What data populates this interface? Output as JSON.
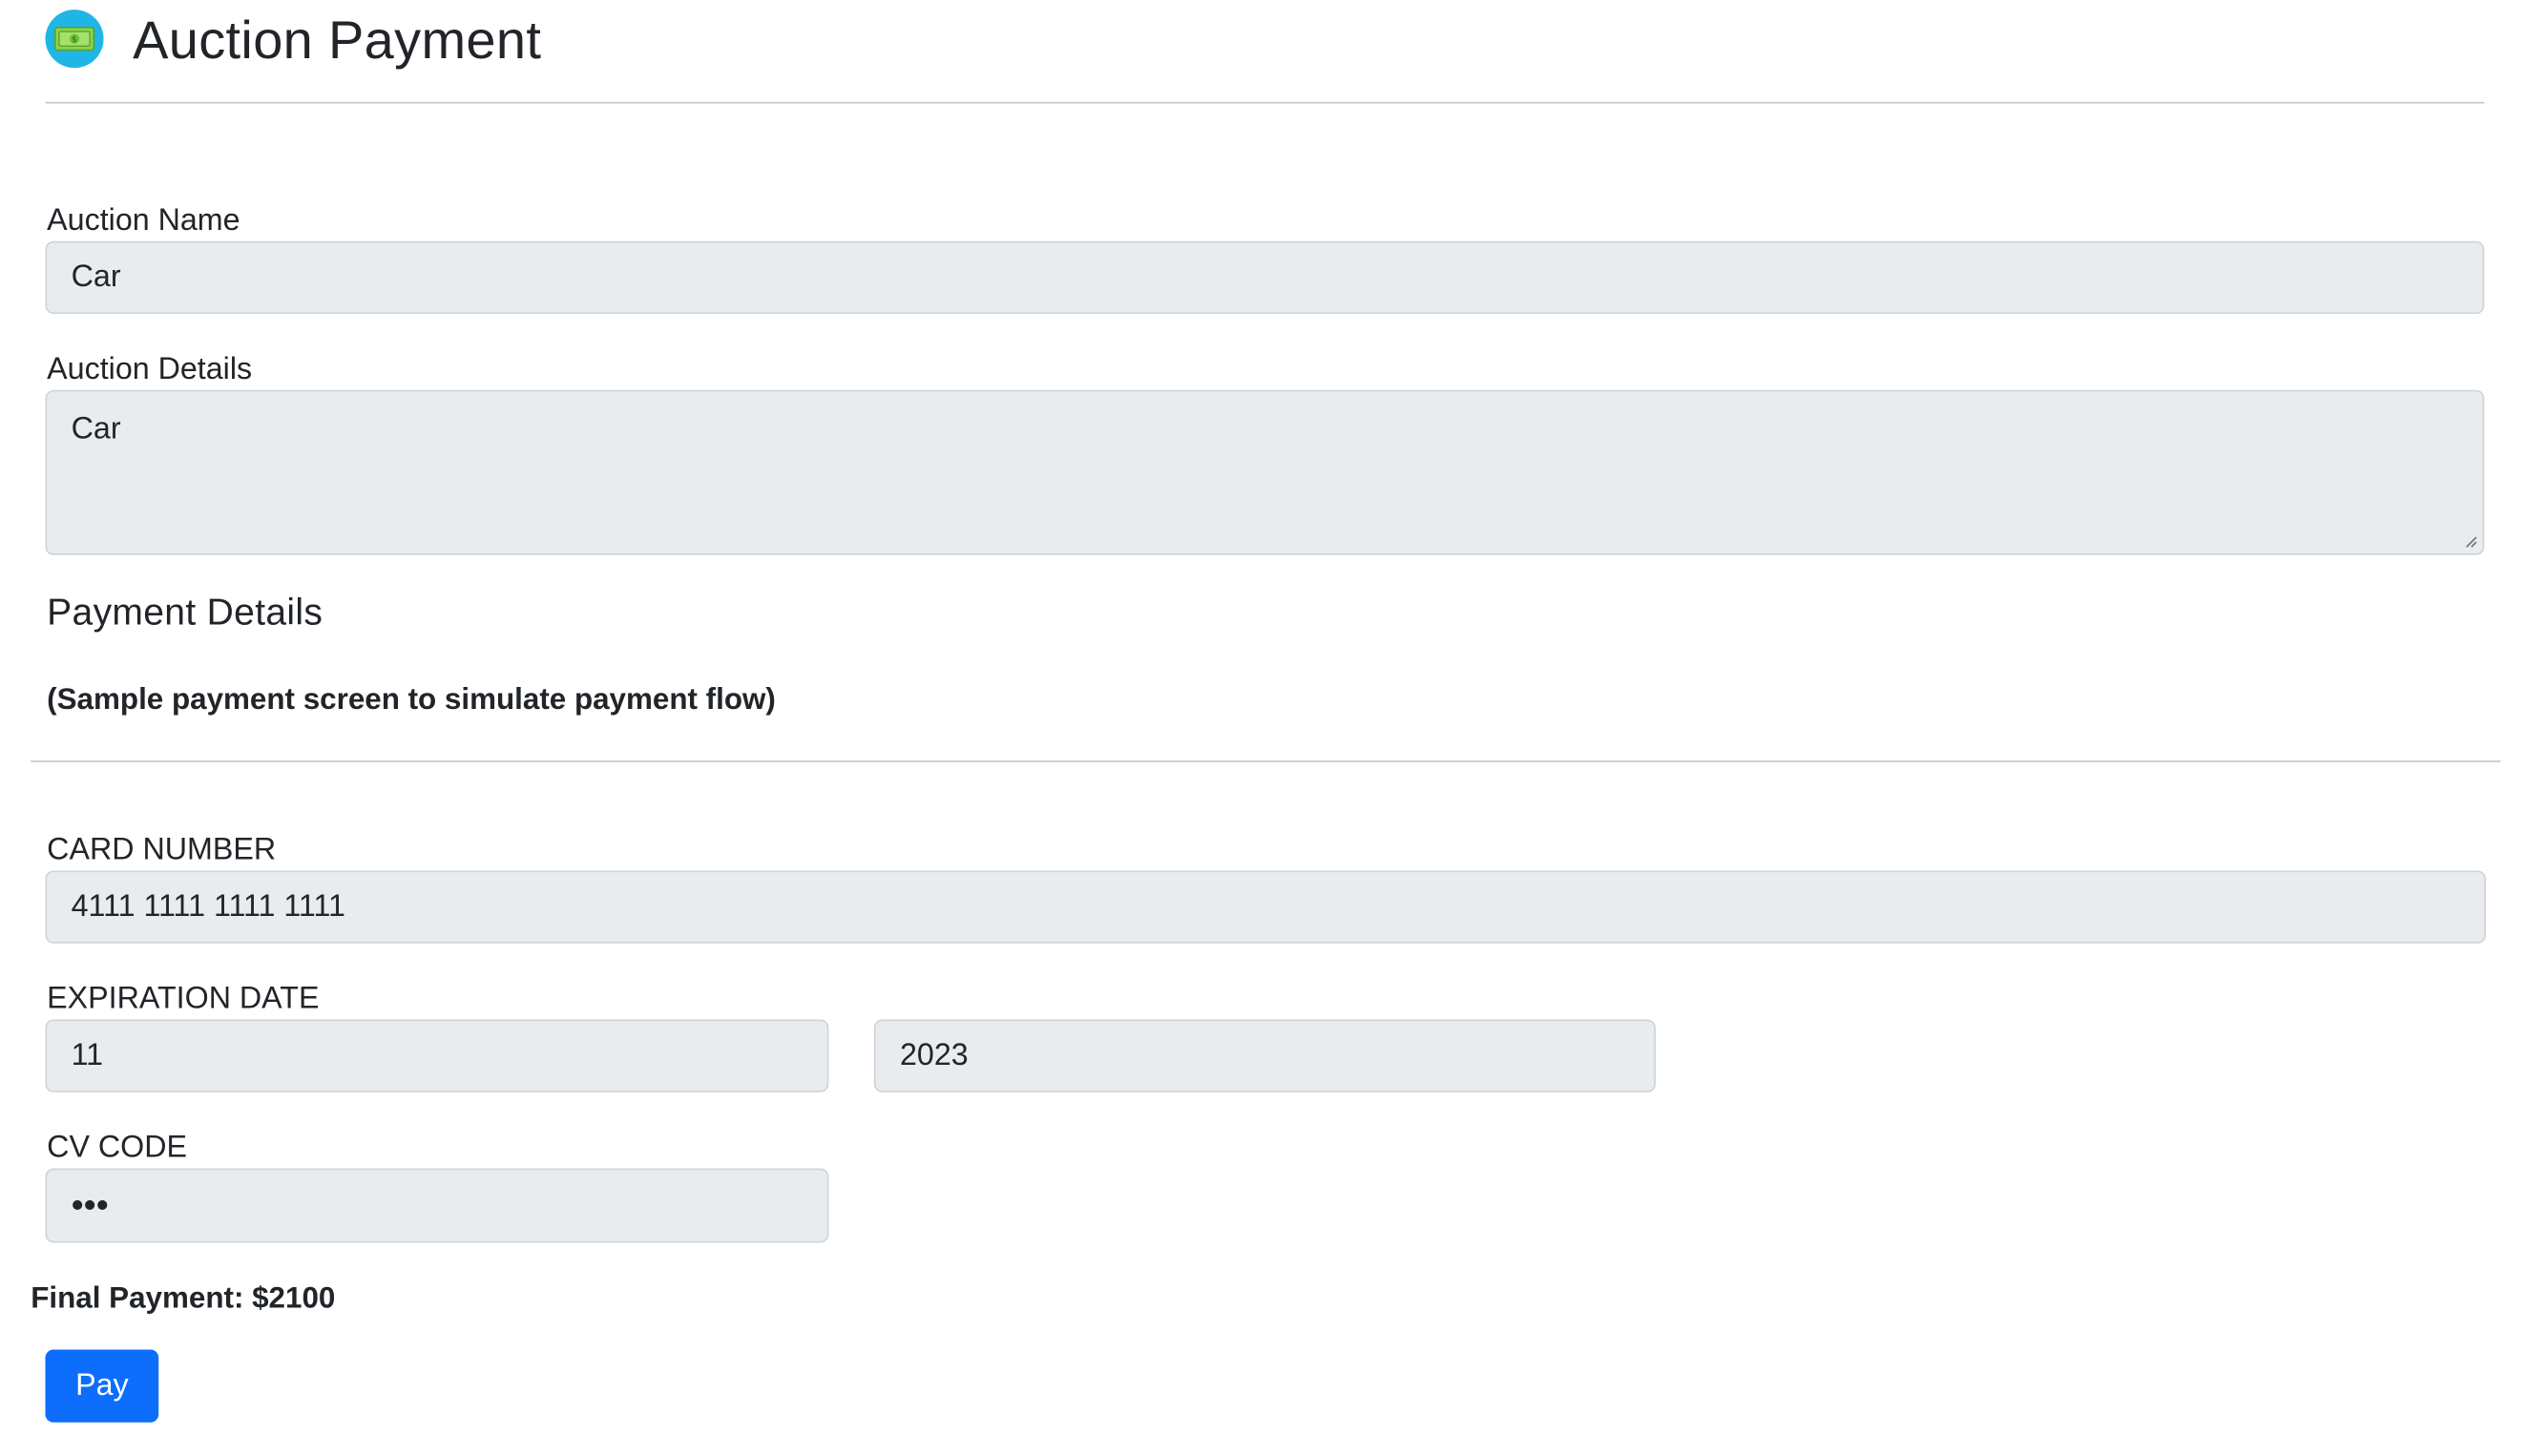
{
  "header": {
    "title": "Auction Payment",
    "icon": "money-icon"
  },
  "auction": {
    "name_label": "Auction Name",
    "name_value": "Car",
    "details_label": "Auction Details",
    "details_value": "Car"
  },
  "payment": {
    "heading": "Payment Details",
    "note": "(Sample payment screen to simulate payment flow)",
    "card_number_label": "CARD NUMBER",
    "card_number_value": "4111 1111 1111 1111",
    "expiration_label": "EXPIRATION DATE",
    "exp_month_value": "11",
    "exp_year_value": "2023",
    "cv_label": "CV CODE",
    "cv_value": "•••",
    "final_payment": "Final Payment: $2100",
    "pay_button": "Pay"
  },
  "colors": {
    "primary": "#0d6efd",
    "field_bg": "#e9ecef",
    "logo_bg": "#1fb6e6"
  }
}
